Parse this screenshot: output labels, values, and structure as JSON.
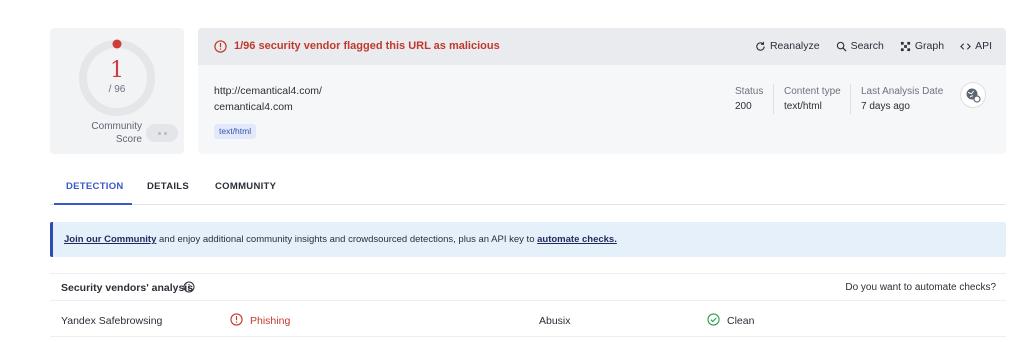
{
  "score": {
    "value": "1",
    "total": "/ 96",
    "community_label_line1": "Community",
    "community_label_line2": "Score",
    "color": "#d23a3a"
  },
  "alert": {
    "text": "1/96 security vendor flagged this URL as malicious",
    "icon": "alert-circle-icon",
    "color": "#c0392b"
  },
  "actions": [
    {
      "label": "Reanalyze",
      "icon": "refresh-icon"
    },
    {
      "label": "Search",
      "icon": "search-icon"
    },
    {
      "label": "Graph",
      "icon": "graph-icon"
    },
    {
      "label": "API",
      "icon": "api-icon"
    }
  ],
  "target": {
    "url": "http://cemantical4.com/",
    "domain": "cemantical4.com",
    "tag": "text/html"
  },
  "meta": {
    "status_label": "Status",
    "status_value": "200",
    "content_type_label": "Content type",
    "content_type_value": "text/html",
    "last_analysis_label": "Last Analysis Date",
    "last_analysis_value": "7 days ago",
    "globe_icon": "globe-link-icon"
  },
  "tabs": [
    {
      "label": "DETECTION",
      "active": true
    },
    {
      "label": "DETAILS",
      "active": false
    },
    {
      "label": "COMMUNITY",
      "active": false
    }
  ],
  "banner": {
    "link1": "Join our Community",
    "middle": " and enjoy additional community insights and crowdsourced detections, plus an API key to ",
    "link2": "automate checks."
  },
  "analysis": {
    "title": "Security vendors' analysis",
    "automate_question": "Do you want to automate checks?"
  },
  "vendors": [
    {
      "name": "Yandex Safebrowsing",
      "result": "Phishing",
      "result_icon": "alert-circle-icon",
      "result_color": "#c0392b"
    },
    {
      "name": "Abusix",
      "result": "Clean",
      "result_icon": "check-circle-icon",
      "result_color": "#2e9e55"
    }
  ]
}
